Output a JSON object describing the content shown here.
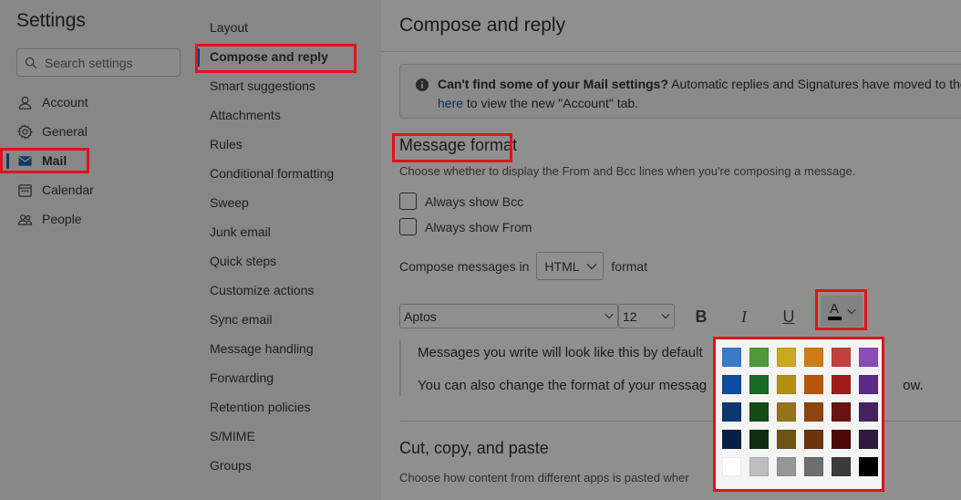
{
  "app_title": "Settings",
  "search": {
    "placeholder": "Search settings"
  },
  "nav": {
    "account": "Account",
    "general": "General",
    "mail": "Mail",
    "calendar": "Calendar",
    "people": "People"
  },
  "subnav": [
    "Layout",
    "Compose and reply",
    "Smart suggestions",
    "Attachments",
    "Rules",
    "Conditional formatting",
    "Sweep",
    "Junk email",
    "Quick steps",
    "Customize actions",
    "Sync email",
    "Message handling",
    "Forwarding",
    "Retention policies",
    "S/MIME",
    "Groups"
  ],
  "page_title": "Compose and reply",
  "info": {
    "bold": "Can't find some of your Mail settings?",
    "rest": "Automatic replies and Signatures have moved to the n",
    "link": "here",
    "line2": "to view the new \"Account\" tab."
  },
  "message_format": {
    "title": "Message format",
    "desc": "Choose whether to display the From and Bcc lines when you're composing a message.",
    "bcc": "Always show Bcc",
    "from": "Always show From",
    "compose_prefix": "Compose messages in",
    "compose_value": "HTML",
    "compose_suffix": "format"
  },
  "toolbar": {
    "font": "Aptos",
    "size": "12",
    "bold": "B",
    "italic": "I",
    "underline": "U",
    "color_letter": "A"
  },
  "preview": {
    "line1": "Messages you write will look like this by default",
    "line2": "You can also change the format of your messag",
    "line2_tail": "ow."
  },
  "cut_copy": {
    "title": "Cut, copy, and paste",
    "desc": "Choose how content from different apps is pasted wher"
  },
  "palette_colors": [
    "#3a7bc8",
    "#4e9a3a",
    "#c8a81e",
    "#d07b1a",
    "#c24040",
    "#8a4db5",
    "#0f4e9e",
    "#166a23",
    "#b38f17",
    "#b5560f",
    "#a41a1a",
    "#5c2a85",
    "#0d3770",
    "#134a17",
    "#94731c",
    "#8f4410",
    "#6b1212",
    "#46215f",
    "#071f45",
    "#0d2e0f",
    "#6e5513",
    "#6b3410",
    "#4a0a0a",
    "#2f1a3d",
    "#ffffff",
    "#bdbdbd",
    "#969696",
    "#6e6e6e",
    "#3b3b3b",
    "#000000"
  ]
}
